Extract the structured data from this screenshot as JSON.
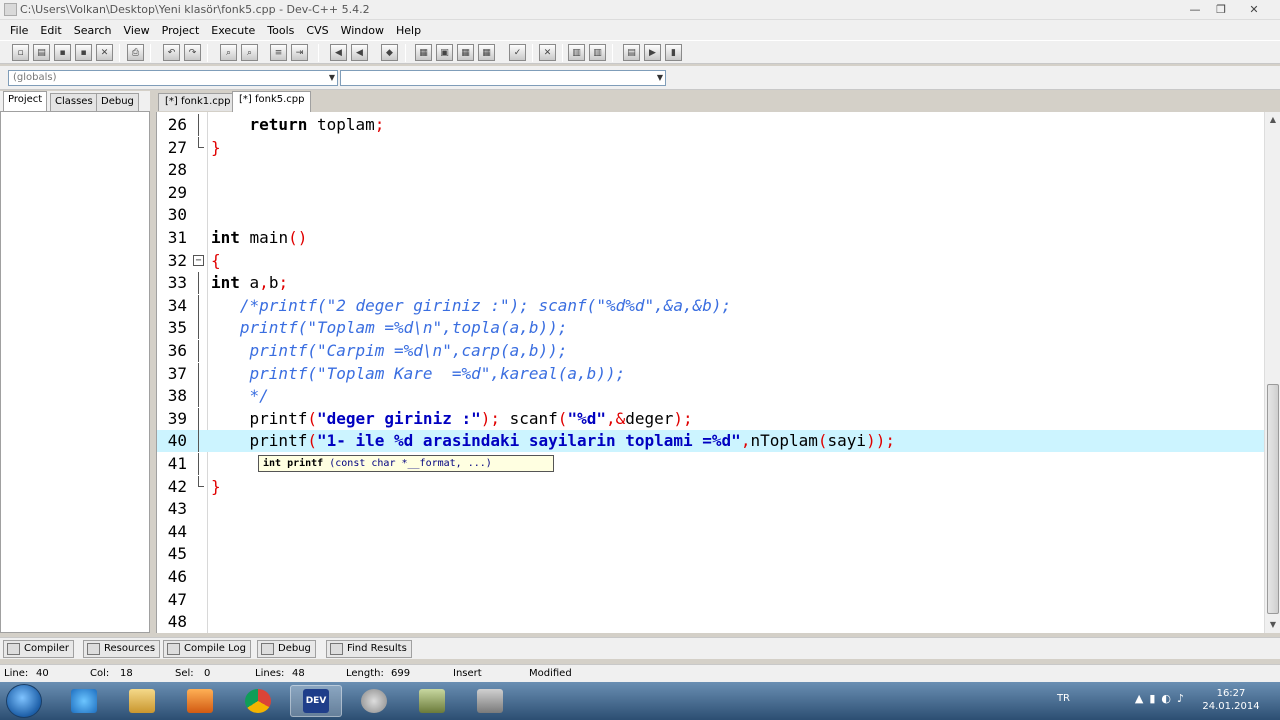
{
  "window": {
    "title": "C:\\Users\\Volkan\\Desktop\\Yeni klasör\\fonk5.cpp - Dev-C++ 5.4.2",
    "min": "—",
    "max": "❐",
    "close": "✕"
  },
  "menu": [
    "File",
    "Edit",
    "Search",
    "View",
    "Project",
    "Execute",
    "Tools",
    "CVS",
    "Window",
    "Help"
  ],
  "scope": {
    "left": "(globals)",
    "right": ""
  },
  "left_tabs": [
    "Project",
    "Classes",
    "Debug"
  ],
  "file_tabs": [
    "[*] fonk1.cpp",
    "[*] fonk5.cpp"
  ],
  "active_file_tab": 1,
  "editor": {
    "lines": [
      {
        "n": "26",
        "tokens": [
          [
            "",
            "    "
          ],
          [
            "kw",
            "return"
          ],
          [
            "",
            " toplam"
          ],
          [
            "red",
            ";"
          ]
        ]
      },
      {
        "n": "27",
        "tokens": [
          [
            "red",
            "}"
          ]
        ]
      },
      {
        "n": "28",
        "tokens": []
      },
      {
        "n": "29",
        "tokens": []
      },
      {
        "n": "30",
        "tokens": []
      },
      {
        "n": "31",
        "tokens": [
          [
            "kw",
            "int"
          ],
          [
            "",
            " main"
          ],
          [
            "red",
            "()"
          ]
        ]
      },
      {
        "n": "32",
        "tokens": [
          [
            "red",
            "{"
          ]
        ]
      },
      {
        "n": "33",
        "tokens": [
          [
            "kw",
            "int"
          ],
          [
            "",
            " a"
          ],
          [
            "red",
            ","
          ],
          [
            "",
            "b"
          ],
          [
            "red",
            ";"
          ]
        ]
      },
      {
        "n": "34",
        "tokens": [
          [
            "cm",
            "   /*printf(\"2 deger giriniz :\"); scanf(\"%d%d\",&a,&b);"
          ]
        ]
      },
      {
        "n": "35",
        "tokens": [
          [
            "cm",
            "   printf(\"Toplam =%d\\n\",topla(a,b));"
          ]
        ]
      },
      {
        "n": "36",
        "tokens": [
          [
            "cm",
            "    printf(\"Carpim =%d\\n\",carp(a,b));"
          ]
        ]
      },
      {
        "n": "37",
        "tokens": [
          [
            "cm",
            "    printf(\"Toplam Kare  =%d\",kareal(a,b));"
          ]
        ]
      },
      {
        "n": "38",
        "tokens": [
          [
            "cm",
            "    */"
          ]
        ]
      },
      {
        "n": "39",
        "tokens": [
          [
            "",
            "    printf"
          ],
          [
            "red",
            "("
          ],
          [
            "str",
            "\"deger giriniz :\""
          ],
          [
            "red",
            ");"
          ],
          [
            "",
            " scanf"
          ],
          [
            "red",
            "("
          ],
          [
            "str",
            "\"%d\""
          ],
          [
            "red",
            ",&"
          ],
          [
            "",
            "deger"
          ],
          [
            "red",
            ");"
          ]
        ]
      },
      {
        "n": "40",
        "tokens": [
          [
            "",
            "    printf"
          ],
          [
            "red",
            "("
          ],
          [
            "str",
            "\"1- ile %d arasindaki sayilarin toplami =%d\""
          ],
          [
            "red",
            ","
          ],
          [
            "",
            "nToplam"
          ],
          [
            "red",
            "("
          ],
          [
            "",
            "sayi"
          ],
          [
            "red",
            "));"
          ]
        ]
      },
      {
        "n": "41",
        "tokens": []
      },
      {
        "n": "42",
        "tokens": [
          [
            "red",
            "}"
          ]
        ]
      },
      {
        "n": "43",
        "tokens": []
      },
      {
        "n": "44",
        "tokens": []
      },
      {
        "n": "45",
        "tokens": []
      },
      {
        "n": "46",
        "tokens": []
      },
      {
        "n": "47",
        "tokens": []
      },
      {
        "n": "48",
        "tokens": []
      }
    ],
    "highlighted_line": "40",
    "calltip_bold": "int printf",
    "calltip_rest": " (const char *__format, ...)"
  },
  "bottom_tabs": [
    "Compiler",
    "Resources",
    "Compile Log",
    "Debug",
    "Find Results"
  ],
  "status": {
    "line_label": "Line:",
    "line": "40",
    "col_label": "Col:",
    "col": "18",
    "sel_label": "Sel:",
    "sel": "0",
    "lines_label": "Lines:",
    "lines": "48",
    "length_label": "Length:",
    "length": "699",
    "mode": "Insert",
    "state": "Modified"
  },
  "taskbar": {
    "lang": "TR",
    "time": "16:27",
    "date": "24.01.2014",
    "items": [
      "ie-icon",
      "explorer-icon",
      "media-player-icon",
      "chrome-icon",
      "devcpp-icon",
      "app-icon",
      "app2-icon",
      "app3-icon"
    ],
    "devcpp_label": "DEV"
  },
  "colors": {
    "keyword": "#000000",
    "symbol": "#e00000",
    "comment": "#3a6ee0",
    "string": "#0000c0",
    "current_line": "#ccf4ff"
  }
}
